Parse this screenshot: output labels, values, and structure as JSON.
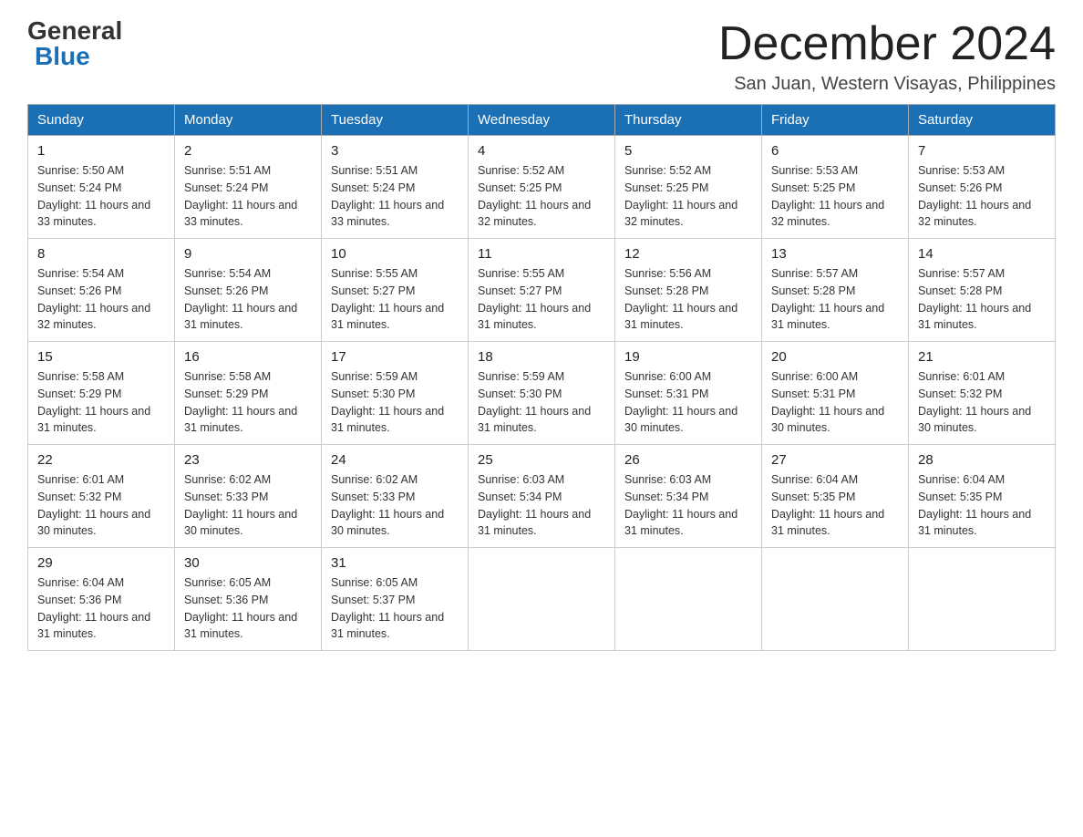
{
  "header": {
    "logo_general": "General",
    "logo_blue": "Blue",
    "month_year": "December 2024",
    "location": "San Juan, Western Visayas, Philippines"
  },
  "days_of_week": [
    "Sunday",
    "Monday",
    "Tuesday",
    "Wednesday",
    "Thursday",
    "Friday",
    "Saturday"
  ],
  "weeks": [
    [
      {
        "day": "1",
        "sunrise": "5:50 AM",
        "sunset": "5:24 PM",
        "daylight": "11 hours and 33 minutes."
      },
      {
        "day": "2",
        "sunrise": "5:51 AM",
        "sunset": "5:24 PM",
        "daylight": "11 hours and 33 minutes."
      },
      {
        "day": "3",
        "sunrise": "5:51 AM",
        "sunset": "5:24 PM",
        "daylight": "11 hours and 33 minutes."
      },
      {
        "day": "4",
        "sunrise": "5:52 AM",
        "sunset": "5:25 PM",
        "daylight": "11 hours and 32 minutes."
      },
      {
        "day": "5",
        "sunrise": "5:52 AM",
        "sunset": "5:25 PM",
        "daylight": "11 hours and 32 minutes."
      },
      {
        "day": "6",
        "sunrise": "5:53 AM",
        "sunset": "5:25 PM",
        "daylight": "11 hours and 32 minutes."
      },
      {
        "day": "7",
        "sunrise": "5:53 AM",
        "sunset": "5:26 PM",
        "daylight": "11 hours and 32 minutes."
      }
    ],
    [
      {
        "day": "8",
        "sunrise": "5:54 AM",
        "sunset": "5:26 PM",
        "daylight": "11 hours and 32 minutes."
      },
      {
        "day": "9",
        "sunrise": "5:54 AM",
        "sunset": "5:26 PM",
        "daylight": "11 hours and 31 minutes."
      },
      {
        "day": "10",
        "sunrise": "5:55 AM",
        "sunset": "5:27 PM",
        "daylight": "11 hours and 31 minutes."
      },
      {
        "day": "11",
        "sunrise": "5:55 AM",
        "sunset": "5:27 PM",
        "daylight": "11 hours and 31 minutes."
      },
      {
        "day": "12",
        "sunrise": "5:56 AM",
        "sunset": "5:28 PM",
        "daylight": "11 hours and 31 minutes."
      },
      {
        "day": "13",
        "sunrise": "5:57 AM",
        "sunset": "5:28 PM",
        "daylight": "11 hours and 31 minutes."
      },
      {
        "day": "14",
        "sunrise": "5:57 AM",
        "sunset": "5:28 PM",
        "daylight": "11 hours and 31 minutes."
      }
    ],
    [
      {
        "day": "15",
        "sunrise": "5:58 AM",
        "sunset": "5:29 PM",
        "daylight": "11 hours and 31 minutes."
      },
      {
        "day": "16",
        "sunrise": "5:58 AM",
        "sunset": "5:29 PM",
        "daylight": "11 hours and 31 minutes."
      },
      {
        "day": "17",
        "sunrise": "5:59 AM",
        "sunset": "5:30 PM",
        "daylight": "11 hours and 31 minutes."
      },
      {
        "day": "18",
        "sunrise": "5:59 AM",
        "sunset": "5:30 PM",
        "daylight": "11 hours and 31 minutes."
      },
      {
        "day": "19",
        "sunrise": "6:00 AM",
        "sunset": "5:31 PM",
        "daylight": "11 hours and 30 minutes."
      },
      {
        "day": "20",
        "sunrise": "6:00 AM",
        "sunset": "5:31 PM",
        "daylight": "11 hours and 30 minutes."
      },
      {
        "day": "21",
        "sunrise": "6:01 AM",
        "sunset": "5:32 PM",
        "daylight": "11 hours and 30 minutes."
      }
    ],
    [
      {
        "day": "22",
        "sunrise": "6:01 AM",
        "sunset": "5:32 PM",
        "daylight": "11 hours and 30 minutes."
      },
      {
        "day": "23",
        "sunrise": "6:02 AM",
        "sunset": "5:33 PM",
        "daylight": "11 hours and 30 minutes."
      },
      {
        "day": "24",
        "sunrise": "6:02 AM",
        "sunset": "5:33 PM",
        "daylight": "11 hours and 30 minutes."
      },
      {
        "day": "25",
        "sunrise": "6:03 AM",
        "sunset": "5:34 PM",
        "daylight": "11 hours and 31 minutes."
      },
      {
        "day": "26",
        "sunrise": "6:03 AM",
        "sunset": "5:34 PM",
        "daylight": "11 hours and 31 minutes."
      },
      {
        "day": "27",
        "sunrise": "6:04 AM",
        "sunset": "5:35 PM",
        "daylight": "11 hours and 31 minutes."
      },
      {
        "day": "28",
        "sunrise": "6:04 AM",
        "sunset": "5:35 PM",
        "daylight": "11 hours and 31 minutes."
      }
    ],
    [
      {
        "day": "29",
        "sunrise": "6:04 AM",
        "sunset": "5:36 PM",
        "daylight": "11 hours and 31 minutes."
      },
      {
        "day": "30",
        "sunrise": "6:05 AM",
        "sunset": "5:36 PM",
        "daylight": "11 hours and 31 minutes."
      },
      {
        "day": "31",
        "sunrise": "6:05 AM",
        "sunset": "5:37 PM",
        "daylight": "11 hours and 31 minutes."
      },
      null,
      null,
      null,
      null
    ]
  ]
}
